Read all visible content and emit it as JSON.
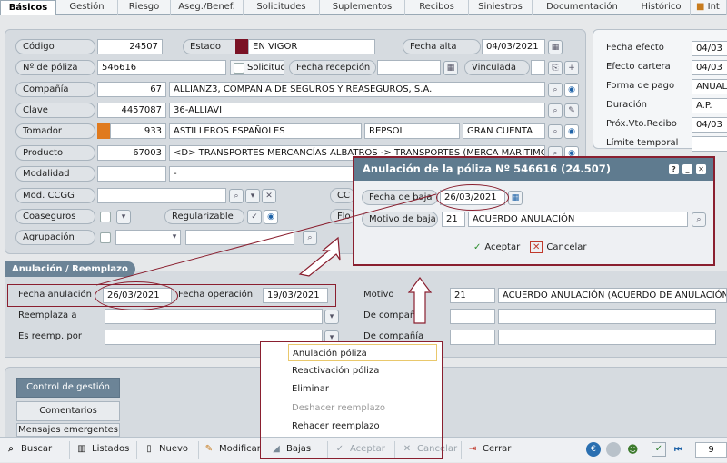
{
  "tabs": [
    "Básicos",
    "Gestión",
    "Riesgo",
    "Aseg./Benef.",
    "Solicitudes",
    "Suplementos",
    "Recibos",
    "Siniestros",
    "Documentación",
    "Histórico",
    "Int"
  ],
  "policy": {
    "codigo_label": "Código",
    "codigo": "24507",
    "estado_label": "Estado",
    "estado": "EN VIGOR",
    "fecha_alta_label": "Fecha alta",
    "fecha_alta": "04/03/2021",
    "poliza_label": "Nº de póliza",
    "poliza": "546616",
    "solicitud_label": "Solicitud",
    "fecha_recepcion_label": "Fecha recepción",
    "vinculada_label": "Vinculada",
    "compania_label": "Compañía",
    "compania_code": "67",
    "compania": "ALLIANZ3, COMPAÑIA DE SEGUROS Y REASEGUROS, S.A.",
    "clave_label": "Clave",
    "clave_code": "4457087",
    "clave": "36-ALLIAVI",
    "tomador_label": "Tomador",
    "tomador_code": "933",
    "tomador": "ASTILLEROS ESPAÑOLES",
    "tomador_extra1": "REPSOL",
    "tomador_extra2": "GRAN CUENTA",
    "producto_label": "Producto",
    "producto_code": "67003",
    "producto": "<D> TRANSPORTES MERCANCÍAS ALBATROS -> TRANSPORTES (MERCA MARITIMO)",
    "modalidad_label": "Modalidad",
    "modalidad": "-",
    "mod_ccgg_label": "Mod. CCGG",
    "cc_label": "CC",
    "coaseguros_label": "Coaseguros",
    "regularizable_label": "Regularizable",
    "flo_label": "Flo",
    "agrupacion_label": "Agrupación"
  },
  "right_panel": {
    "fecha_efecto_label": "Fecha efecto",
    "fecha_efecto": "04/03",
    "fecha_cartera_label": "Efecto cartera",
    "fecha_cartera": "04/03",
    "forma_pago_label": "Forma de pago",
    "forma_pago": "ANUAL",
    "duracion_label": "Duración",
    "duracion": "A.P.",
    "prox_vto_label": "Próx.Vto.Recibo",
    "prox_vto": "04/03",
    "limite_label": "Límite temporal"
  },
  "anulacion": {
    "section_title": "Anulación / Reemplazo",
    "fecha_anulacion_label": "Fecha anulación",
    "fecha_anulacion": "26/03/2021",
    "fecha_operacion_label": "Fecha operación",
    "fecha_operacion": "19/03/2021",
    "motivo_label": "Motivo",
    "motivo_code": "21",
    "motivo": "ACUERDO ANULACIÓN (ACUERDO DE ANULACIÓN)",
    "reemplaza_label": "Reemplaza a",
    "de_compania_label": "De compañía",
    "es_reemp_label": "Es reemp. por",
    "de_compania2_label": "De compañía"
  },
  "side_buttons": [
    "Control de gestión",
    "Comentarios",
    "Mensajes emergentes"
  ],
  "dialog": {
    "title": "Anulación de la póliza Nº 546616 (24.507)",
    "fecha_baja_label": "Fecha de baja",
    "fecha_baja": "26/03/2021",
    "motivo_baja_label": "Motivo de baja",
    "motivo_baja_code": "21",
    "motivo_baja": "ACUERDO ANULACIÓN",
    "accept_label": "Aceptar",
    "cancel_label": "Cancelar"
  },
  "menu": [
    "Anulación póliza",
    "Reactivación póliza",
    "Eliminar",
    "Deshacer reemplazo",
    "Rehacer reemplazo"
  ],
  "toolbar": {
    "buscar": "Buscar",
    "listados": "Listados",
    "nuevo": "Nuevo",
    "modificar": "Modificar",
    "bajas": "Bajas",
    "aceptar": "Aceptar",
    "cancelar": "Cancelar",
    "cerrar": "Cerrar",
    "page": "9"
  },
  "colors": {
    "accent": "#8a1f2f",
    "header": "#5f7b8f",
    "section": "#6c8497"
  }
}
